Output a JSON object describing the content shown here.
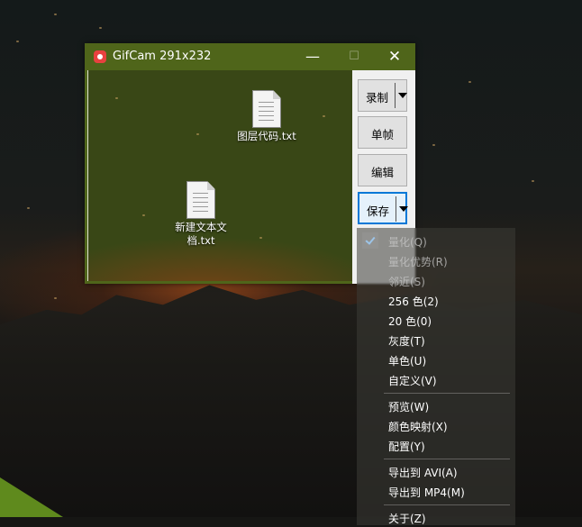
{
  "window": {
    "title": "GifCam 291x232",
    "minimize": "—",
    "maximize": "☐",
    "close": "✕"
  },
  "desktop_icons": [
    {
      "label": "图层代码.txt"
    },
    {
      "label": "新建文本文档.txt"
    }
  ],
  "side_buttons": {
    "record": "录制",
    "frame": "单帧",
    "edit": "编辑",
    "save": "保存"
  },
  "menu": {
    "items": [
      {
        "label": "量化(Q)",
        "checked": true,
        "disabled": true
      },
      {
        "label": "量化优势(R)",
        "disabled": true
      },
      {
        "label": "邻近(S)",
        "disabled": true
      },
      {
        "label": "256 色(2)"
      },
      {
        "label": "20 色(0)"
      },
      {
        "label": "灰度(T)"
      },
      {
        "label": "单色(U)"
      },
      {
        "label": "自定义(V)"
      },
      {
        "label": "预览(W)"
      },
      {
        "label": "颜色映射(X)"
      },
      {
        "label": "配置(Y)"
      },
      {
        "label": "导出到 AVI(A)"
      },
      {
        "label": "导出到 MP4(M)"
      },
      {
        "label": "关于(Z)"
      }
    ]
  },
  "colors": {
    "titlebar": "#4f651a",
    "accent": "#0078d7"
  }
}
